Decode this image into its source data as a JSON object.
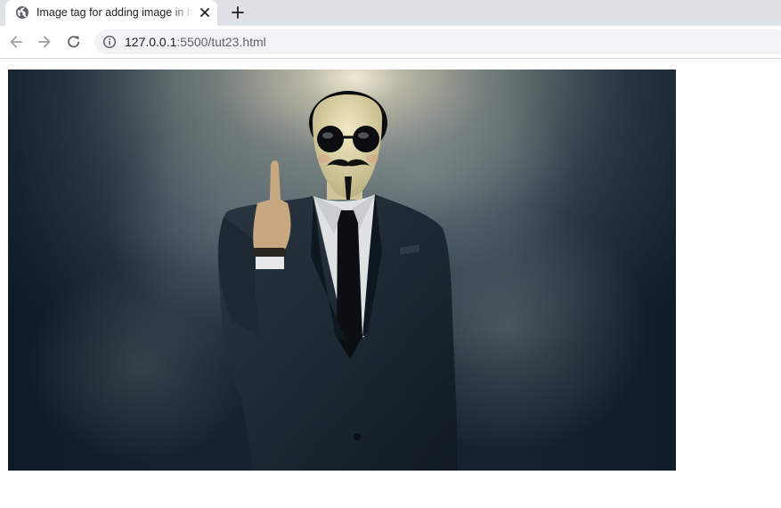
{
  "browser": {
    "tab": {
      "title": "Image tag for adding image in html",
      "favicon": "globe-icon"
    },
    "toolbar": {
      "back_icon": "back-arrow-icon",
      "forward_icon": "forward-arrow-icon",
      "reload_icon": "reload-icon",
      "site_info_icon": "info-icon",
      "url_host": "127.0.0.1",
      "url_rest": ":5500/tut23.html"
    }
  },
  "page": {
    "image": {
      "subject": "Man in black suit and Guy Fawkes mask with sunglasses, raising middle finger, against smoky spotlit background"
    }
  },
  "colors": {
    "tabstrip_bg": "#dee1e6",
    "omnibox_bg": "#f1f3f4",
    "icon_gray": "#5f6368",
    "disabled_gray": "#9aa0a6"
  }
}
